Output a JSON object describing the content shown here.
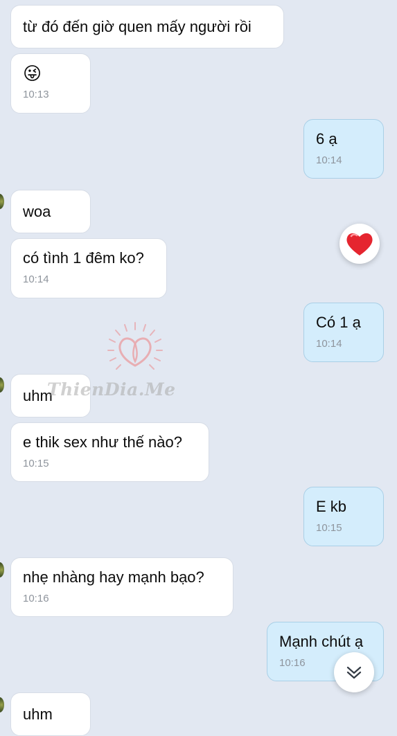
{
  "messages": [
    {
      "text": "từ đó đến giờ quen mấy người rồi",
      "time": ""
    },
    {
      "text": "😜",
      "time": "10:13"
    },
    {
      "text": "6 ạ",
      "time": "10:14"
    },
    {
      "text": "woa",
      "time": ""
    },
    {
      "text": "có tình 1 đêm ko?",
      "time": "10:14"
    },
    {
      "text": "Có 1 ạ",
      "time": "10:14"
    },
    {
      "text": "uhm",
      "time": ""
    },
    {
      "text": "e thik sex như thế nào?",
      "time": "10:15"
    },
    {
      "text": "E kb",
      "time": "10:15"
    },
    {
      "text": "nhẹ nhàng hay mạnh bạo?",
      "time": "10:16"
    },
    {
      "text": "Mạnh chút ạ",
      "time": "10:16"
    },
    {
      "text": "uhm",
      "time": ""
    }
  ],
  "reaction": {
    "icon": "heart-icon",
    "color": "#e5252f"
  },
  "scroll_button": {
    "icon": "double-chevron-down-icon"
  },
  "watermark": {
    "text": "ThienDia.Me",
    "icon": "heart-logo-icon",
    "color": "#e9a3a8"
  },
  "colors": {
    "background": "#e2e8f2",
    "incoming_bubble": "#ffffff",
    "outgoing_bubble": "#d4edfc"
  }
}
